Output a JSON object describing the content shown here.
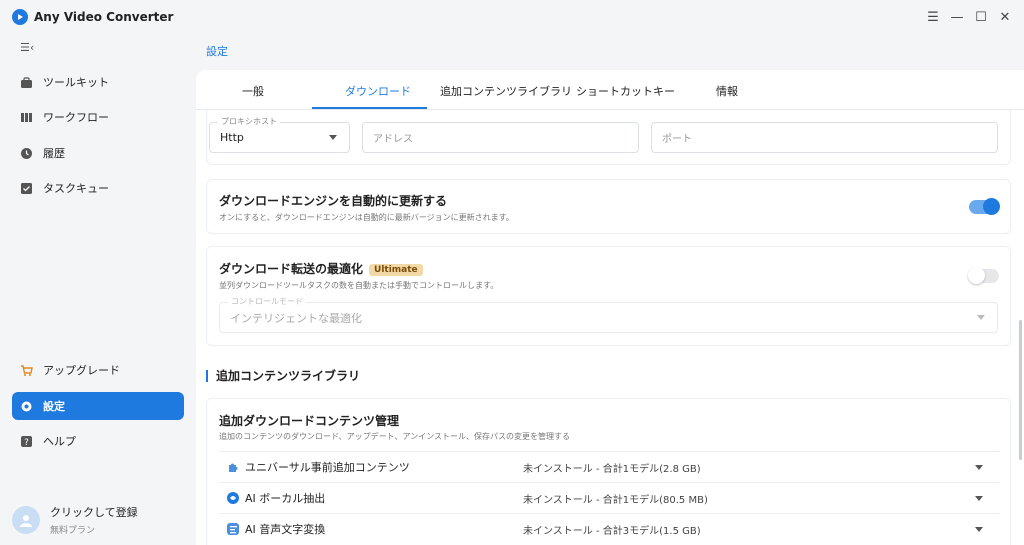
{
  "app": {
    "title": "Any Video Converter",
    "accent": "#1f7ae0"
  },
  "sidebar": {
    "items": [
      {
        "label": "ツールキット",
        "icon": "toolbox-icon"
      },
      {
        "label": "ワークフロー",
        "icon": "workflow-icon"
      },
      {
        "label": "履歴",
        "icon": "history-icon"
      },
      {
        "label": "タスクキュー",
        "icon": "task-queue-icon"
      }
    ],
    "bottom_items": [
      {
        "label": "アップグレード",
        "icon": "cart-icon"
      },
      {
        "label": "設定",
        "icon": "gear-icon",
        "active": true
      },
      {
        "label": "ヘルプ",
        "icon": "help-icon"
      }
    ],
    "user": {
      "name": "クリックして登録",
      "plan": "無料プラン"
    }
  },
  "breadcrumb": "設定",
  "tabs": [
    {
      "label": "一般"
    },
    {
      "label": "ダウンロード",
      "active": true
    },
    {
      "label": "追加コンテンツライブラリ"
    },
    {
      "label": "ショートカットキー"
    },
    {
      "label": "情報"
    }
  ],
  "proxy": {
    "host_label": "プロキシホスト",
    "host_value": "Http",
    "address_placeholder": "アドレス",
    "port_placeholder": "ポート"
  },
  "engine_update": {
    "title": "ダウンロードエンジンを自動的に更新する",
    "desc": "オンにすると、ダウンロードエンジンは自動的に最新バージョンに更新されます。",
    "enabled": true
  },
  "transfer_opt": {
    "title": "ダウンロード転送の最適化",
    "badge": "Ultimate",
    "desc": "並列ダウンロードツールタスクの数を自動または手動でコントロールします。",
    "enabled": false,
    "mode_label": "コントロールモード",
    "mode_value": "インテリジェントな最適化"
  },
  "library": {
    "section_title": "追加コンテンツライブラリ",
    "card_title": "追加ダウンロードコンテンツ管理",
    "card_desc": "追加のコンテンツのダウンロード、アップデート、アンインストール、保存パスの変更を管理する",
    "rows": [
      {
        "name": "ユニバーサル事前追加コンテンツ",
        "status": "未インストール - 合計1モデル(2.8 GB)",
        "icon": "puzzle-icon"
      },
      {
        "name": "AI ボーカル抽出",
        "status": "未インストール - 合計1モデル(80.5 MB)",
        "icon": "vocal-icon"
      },
      {
        "name": "AI 音声文字変換",
        "status": "未インストール - 合計3モデル(1.5 GB)",
        "icon": "transcribe-icon"
      }
    ]
  }
}
